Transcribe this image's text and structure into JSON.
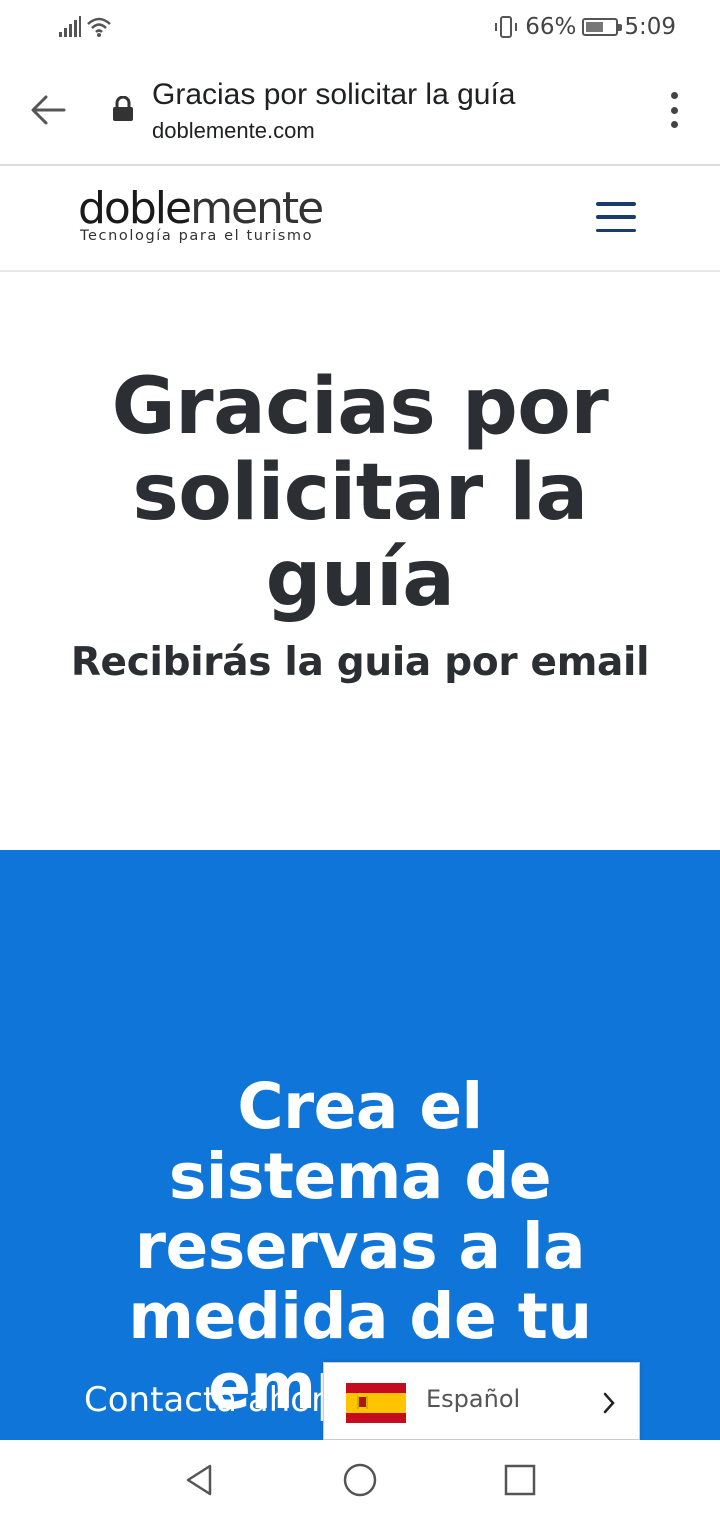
{
  "status_bar": {
    "battery_percent": "66%",
    "battery_level": 0.66,
    "time": "5:09"
  },
  "browser": {
    "page_title": "Gracias por solicitar la guía",
    "domain": "doblemente.com"
  },
  "site": {
    "logo_bold": "doble",
    "logo_light": "mente",
    "logo_tagline": "Tecnología para el turismo",
    "accent_color": "#0f75d8",
    "menu_color": "#1a3b6e"
  },
  "hero": {
    "title": "Gracias por solicitar la guía",
    "subtitle": "Recibirás la guia por email"
  },
  "cta": {
    "title": "Crea el sistema de reservas a la medida de tu empresa",
    "contact_link": "Contacta ahora"
  },
  "language_widget": {
    "label": "Español",
    "flag": "spain-flag-icon"
  },
  "icons": {
    "signal": "signal-icon",
    "wifi": "wifi-icon",
    "vibrate": "vibrate-icon",
    "battery": "battery-icon",
    "back": "back-arrow-icon",
    "lock": "lock-icon",
    "overflow_menu": "more-vert-icon",
    "hamburger": "hamburger-menu-icon",
    "nav_back": "nav-back-icon",
    "nav_home": "nav-home-icon",
    "nav_recents": "nav-recents-icon"
  }
}
